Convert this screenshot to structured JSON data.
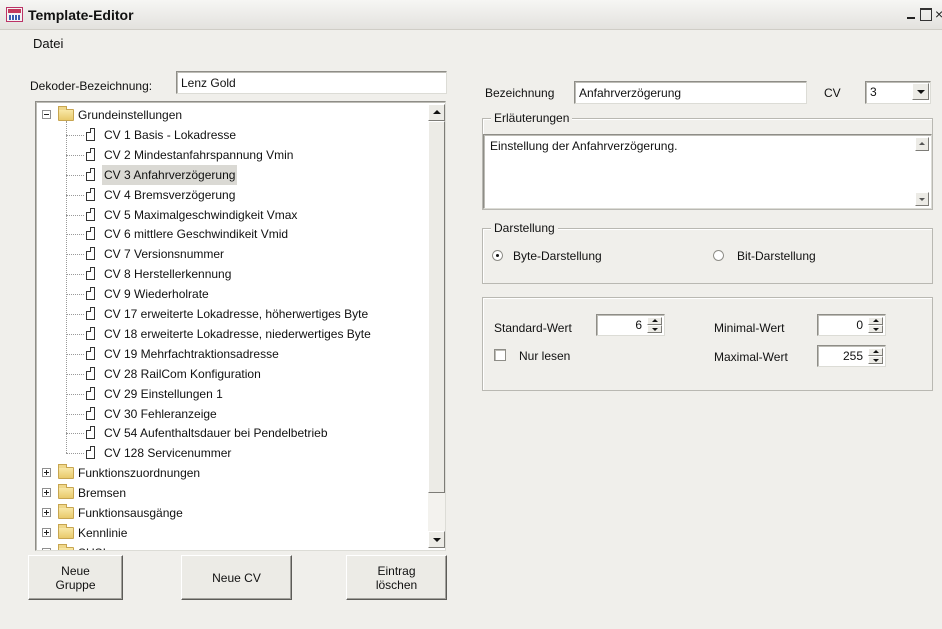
{
  "window": {
    "title": "Template-Editor",
    "minimize": "_",
    "close": "×"
  },
  "menu": {
    "datei": "Datei"
  },
  "decoder": {
    "label": "Dekoder-Bezeichnung:",
    "value": "Lenz Gold"
  },
  "tree": {
    "groups_top": [
      {
        "label": "Grundeinstellungen",
        "expander": "minus"
      }
    ],
    "leaves": [
      {
        "label": "CV 1 Basis - Lokadresse"
      },
      {
        "label": "CV 2 Mindestanfahrspannung Vmin"
      },
      {
        "label": "CV 3 Anfahrverzögerung",
        "selected": true
      },
      {
        "label": "CV 4 Bremsverzögerung"
      },
      {
        "label": "CV 5 Maximalgeschwindigkeit Vmax"
      },
      {
        "label": "CV 6 mittlere Geschwindikeit Vmid"
      },
      {
        "label": "CV 7 Versionsnummer"
      },
      {
        "label": "CV 8 Herstellerkennung"
      },
      {
        "label": "CV 9 Wiederholrate"
      },
      {
        "label": "CV 17 erweiterte Lokadresse, höherwertiges Byte"
      },
      {
        "label": "CV 18 erweiterte Lokadresse, niederwertiges Byte"
      },
      {
        "label": "CV 19 Mehrfachtraktionsadresse"
      },
      {
        "label": "CV 28 RailCom Konfiguration"
      },
      {
        "label": "CV 29 Einstellungen 1"
      },
      {
        "label": "CV 30 Fehleranzeige"
      },
      {
        "label": "CV 54 Aufenthaltsdauer bei Pendelbetrieb"
      },
      {
        "label": "CV 128 Servicenummer"
      }
    ],
    "groups_bottom": [
      {
        "label": "Funktionszuordnungen"
      },
      {
        "label": "Bremsen"
      },
      {
        "label": "Funktionsausgänge"
      },
      {
        "label": "Kennlinie"
      },
      {
        "label": "SUSI"
      }
    ]
  },
  "buttons": {
    "new_group": "Neue\nGruppe",
    "new_cv": "Neue CV",
    "delete_entry": "Eintrag\nlöschen"
  },
  "detail": {
    "bezeichnung_label": "Bezeichnung",
    "bezeichnung_value": "Anfahrverzögerung",
    "cv_label": "CV",
    "cv_value": "3"
  },
  "erlaeuterungen": {
    "title": "Erläuterungen",
    "text": "Einstellung der Anfahrverzögerung."
  },
  "darstellung": {
    "title": "Darstellung",
    "byte_label": "Byte-Darstellung",
    "byte_checked": true,
    "bit_label": "Bit-Darstellung",
    "bit_checked": false
  },
  "values": {
    "standard_label": "Standard-Wert",
    "standard_value": "6",
    "minimal_label": "Minimal-Wert",
    "minimal_value": "0",
    "maximal_label": "Maximal-Wert",
    "maximal_value": "255",
    "readonly_label": "Nur lesen",
    "readonly_checked": false
  }
}
